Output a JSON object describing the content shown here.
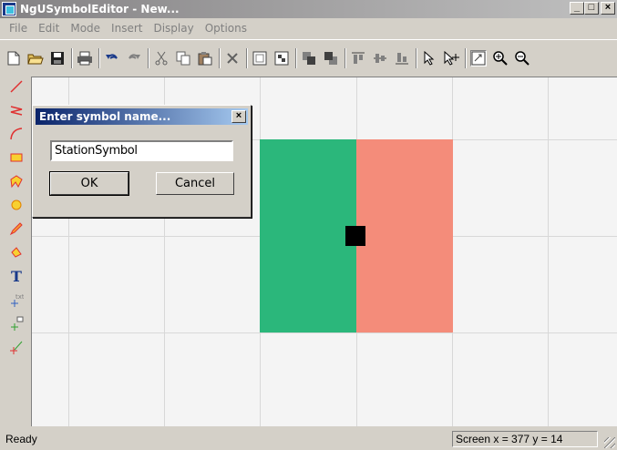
{
  "window": {
    "title": "NgUSymbolEditor - New...",
    "minimize": "_",
    "maximize": "□",
    "close": "×"
  },
  "menu": [
    "File",
    "Edit",
    "Mode",
    "Insert",
    "Display",
    "Options"
  ],
  "toolbar": {
    "icons": [
      "new-file-icon",
      "open-folder-icon",
      "save-icon",
      "print-icon",
      "undo-icon",
      "redo-icon",
      "cut-icon",
      "copy-icon",
      "paste-icon",
      "delete-icon",
      "group-icon",
      "ungroup-icon",
      "bring-front-icon",
      "send-back-icon",
      "align-top-icon",
      "align-middle-icon",
      "align-bottom-icon",
      "select-arrow-icon",
      "select-move-icon",
      "zoom-fit-icon",
      "zoom-in-icon",
      "zoom-out-icon"
    ]
  },
  "palette": {
    "icons": [
      "line-tool-icon",
      "polyline-tool-icon",
      "arc-tool-icon",
      "rectangle-tool-icon",
      "polygon-tool-icon",
      "ellipse-tool-icon",
      "pen-tool-icon",
      "fill-tool-icon",
      "text-tool-icon",
      "text-anchor-icon",
      "connect-point-icon",
      "connect-line-icon"
    ]
  },
  "canvas": {
    "colors": {
      "green": "#2bb77b",
      "salmon": "#f48c7a",
      "square": "#000000"
    }
  },
  "dialog": {
    "title": "Enter symbol name...",
    "input_value": "StationSymbol",
    "ok_label": "OK",
    "cancel_label": "Cancel",
    "close": "×"
  },
  "status": {
    "left": "Ready",
    "coords": "Screen  x = 377  y = 14"
  }
}
